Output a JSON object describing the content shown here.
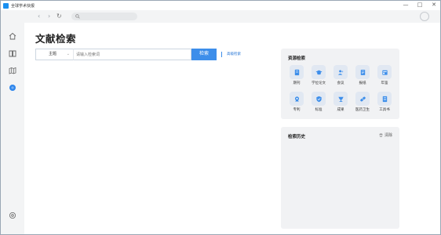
{
  "window": {
    "title": "全球学术快报",
    "controls": {
      "minimize": "—",
      "maximize": "□",
      "close": "✕"
    }
  },
  "nav": {
    "back": "‹",
    "forward": "›",
    "reload": "↻",
    "address_value": ""
  },
  "sidebar": {
    "items": [
      {
        "name": "home",
        "icon": "home-icon",
        "active": false
      },
      {
        "name": "library",
        "icon": "book-icon",
        "active": false
      },
      {
        "name": "map",
        "icon": "map-icon",
        "active": false
      },
      {
        "name": "search",
        "icon": "search-dot-icon",
        "active": true
      },
      {
        "name": "settings",
        "icon": "gear-icon",
        "active": false
      }
    ]
  },
  "main": {
    "title": "文献检索",
    "search": {
      "scope": "主题",
      "placeholder": "请输入检索词",
      "value": "",
      "button": "检索",
      "advanced": "高级检索"
    }
  },
  "resources": {
    "title": "资源检索",
    "items": [
      {
        "label": "期刊",
        "icon": "journal-icon"
      },
      {
        "label": "学位论文",
        "icon": "graduation-cap-icon"
      },
      {
        "label": "会议",
        "icon": "people-icon"
      },
      {
        "label": "报纸",
        "icon": "newspaper-icon"
      },
      {
        "label": "年鉴",
        "icon": "yearbook-icon"
      },
      {
        "label": "专利",
        "icon": "patent-icon"
      },
      {
        "label": "标准",
        "icon": "shield-check-icon"
      },
      {
        "label": "成果",
        "icon": "trophy-icon"
      },
      {
        "label": "医药卫生",
        "icon": "pill-icon"
      },
      {
        "label": "工具书",
        "icon": "reference-book-icon"
      }
    ]
  },
  "history": {
    "title": "检索历史",
    "clear": "清除"
  },
  "colors": {
    "accent": "#3d8eea",
    "link": "#1e70d4",
    "panel_bg": "#f1f2f4",
    "icon_tile": "#e1e8f2",
    "sidebar_bg": "#f3f4f5"
  }
}
